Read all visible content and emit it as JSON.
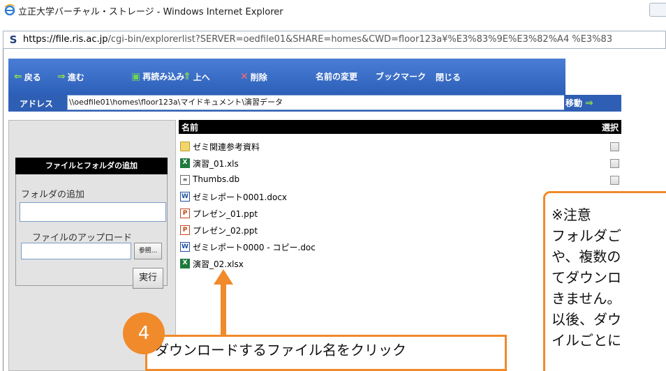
{
  "window": {
    "title": "立正大学バーチャル・ストレージ - Windows Internet Explorer",
    "url_host": "https://file.ris.ac.jp",
    "url_path": "/cgi-bin/explorerlist?SERVER=oedfile01&SHARE=homes&CWD=floor123a¥%E3%83%9E%E3%82%A4 %E3%83"
  },
  "toolbar": {
    "back": "戻る",
    "forward": "進む",
    "reload": "再読み込み",
    "up": "上へ",
    "delete": "削除",
    "rename": "名前の変更",
    "bookmark": "ブックマーク",
    "close": "閉じる"
  },
  "address": {
    "label": "アドレス",
    "value": "\\\\oedfile01\\homes\\floor123a\\マイドキュメント\\演習データ",
    "go": "移動"
  },
  "sidepanel": {
    "header": "ファイルとフォルダの追加",
    "folder_label": "フォルダの追加",
    "folder_value": "",
    "upload_label": "ファイルのアップロード",
    "upload_value": "",
    "browse": "参照...",
    "run": "実行"
  },
  "filelist": {
    "col_name": "名前",
    "col_select": "選択",
    "files": [
      {
        "name": "ゼミ関連参考資料",
        "type": "folder",
        "icon": "folder-icon"
      },
      {
        "name": "演習_01.xls",
        "type": "xls",
        "icon": "excel-icon"
      },
      {
        "name": "Thumbs.db",
        "type": "db",
        "icon": "db-file-icon"
      },
      {
        "name": "ゼミレポート0001.docx",
        "type": "doc",
        "icon": "word-icon"
      },
      {
        "name": "プレゼン_01.ppt",
        "type": "ppt",
        "icon": "powerpoint-icon"
      },
      {
        "name": "プレゼン_02.ppt",
        "type": "ppt",
        "icon": "powerpoint-icon"
      },
      {
        "name": "ゼミレポート0000 - コピー.doc",
        "type": "doc",
        "icon": "word-icon"
      },
      {
        "name": "演習_02.xlsx",
        "type": "xls",
        "icon": "excel-icon"
      }
    ]
  },
  "annotation": {
    "step": "4",
    "text": "ダウンロードするファイル名をクリック",
    "accent_color": "#f08a2a"
  },
  "note": {
    "lines": [
      "※注意",
      "フォルダご",
      "や、複数の",
      "てダウンロ",
      "きません。",
      "以後、ダウ",
      "イルごとに"
    ]
  }
}
